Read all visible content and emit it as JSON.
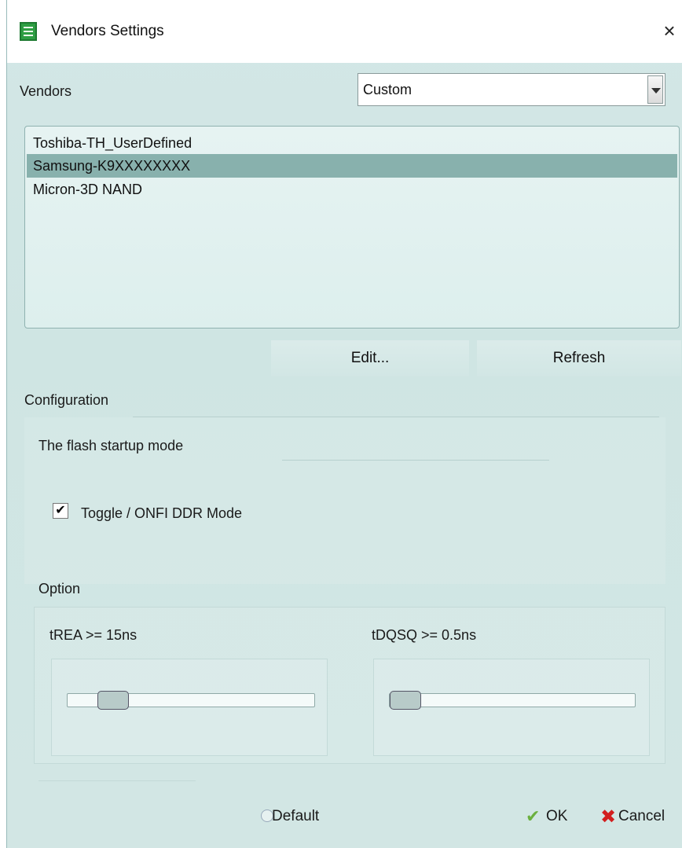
{
  "window": {
    "title": "Vendors Settings",
    "close_glyph": "×",
    "app_icon": "document-list-icon"
  },
  "vendors": {
    "label": "Vendors",
    "dropdown_value": "Custom",
    "items": [
      {
        "label": "Toshiba-TH_UserDefined",
        "selected": false
      },
      {
        "label": "Samsung-K9XXXXXXXX",
        "selected": true
      },
      {
        "label": "Micron-3D NAND",
        "selected": false
      }
    ],
    "edit_label": "Edit...",
    "refresh_label": "Refresh"
  },
  "configuration": {
    "label": "Configuration",
    "startup_mode_label": "The flash startup mode",
    "toggle_label": "Toggle / ONFI DDR Mode",
    "toggle_checked": true,
    "check_glyph": "✔"
  },
  "option": {
    "label": "Option",
    "trea_label": "tREA >= 15ns",
    "tdqsq_label": "tDQSQ >= 0.5ns",
    "trea_level": 0.14,
    "tdqsq_level": 0.0
  },
  "footer": {
    "default_label": "Default",
    "ok_label": "OK",
    "cancel_label": "Cancel",
    "ok_glyph": "✔",
    "cancel_glyph": "✖"
  },
  "colors": {
    "background": "#d2e6e4",
    "selection": "#88b1ad",
    "ok_icon": "#6bb03f",
    "cancel_icon": "#d21f1f"
  }
}
